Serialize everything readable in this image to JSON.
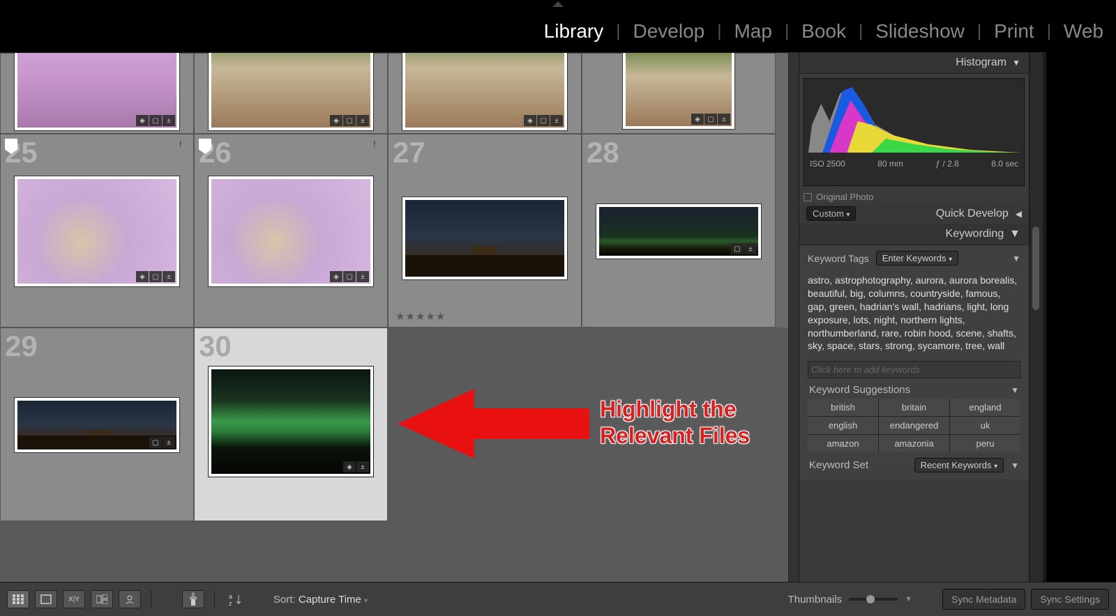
{
  "modules": {
    "items": [
      "Library",
      "Develop",
      "Map",
      "Book",
      "Slideshow",
      "Print",
      "Web"
    ],
    "active": "Library"
  },
  "annotation": {
    "line1": "Highlight the",
    "line2": "Relevant Files"
  },
  "grid": {
    "row2": {
      "n25": "25",
      "n26": "26",
      "n27": "27",
      "n28": "28"
    },
    "row3": {
      "n29": "29",
      "n30": "30"
    },
    "stars27": "★★★★★"
  },
  "histogram": {
    "title": "Histogram",
    "iso": "ISO 2500",
    "focal": "80 mm",
    "aperture": "ƒ / 2.8",
    "shutter": "8.0 sec",
    "original": "Original Photo"
  },
  "quick_develop": {
    "dropdown": "Custom",
    "title": "Quick Develop"
  },
  "keywording": {
    "title": "Keywording",
    "tags_label": "Keyword Tags",
    "tags_dd": "Enter Keywords",
    "tags_text": "astro, astrophotography, aurora, aurora borealis, beautiful, big, columns, countryside, famous, gap, green, hadrian's wall, hadrians, light, long exposure, lots, night, northern lights, northumberland, rare, robin hood, scene, shafts, sky, space, stars, strong, sycamore, tree, wall",
    "placeholder": "Click here to add keywords",
    "suggestions_label": "Keyword Suggestions",
    "suggestions": [
      "british",
      "britain",
      "england",
      "english",
      "endangered",
      "uk",
      "amazon",
      "amazonia",
      "peru"
    ],
    "set_label": "Keyword Set",
    "set_dd": "Recent Keywords"
  },
  "bottombar": {
    "sort_label": "Sort:",
    "sort_value": "Capture Time",
    "thumbs_label": "Thumbnails",
    "sync_meta": "Sync Metadata",
    "sync_settings": "Sync Settings"
  }
}
